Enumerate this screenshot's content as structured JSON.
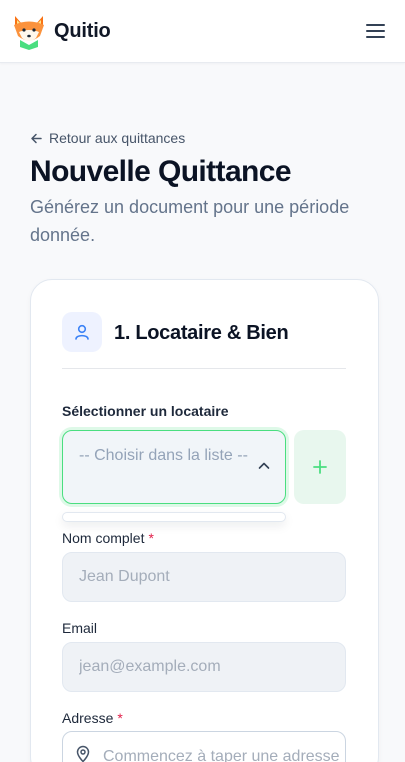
{
  "app": {
    "brand": "Quitio"
  },
  "nav": {
    "back_label": "Retour aux quittances"
  },
  "page": {
    "title": "Nouvelle Quittance",
    "subtitle": "Générez un document pour une période donnée."
  },
  "section": {
    "title": "1. Locataire & Bien"
  },
  "form": {
    "tenant_select": {
      "label": "Sélectionner un locataire",
      "selected": "-- Choisir dans la liste --"
    },
    "full_name": {
      "label": "Nom complet",
      "required_mark": "*",
      "placeholder": "Jean Dupont",
      "value": ""
    },
    "email": {
      "label": "Email",
      "placeholder": "jean@example.com",
      "value": ""
    },
    "address": {
      "label": "Adresse",
      "required_mark": "*",
      "placeholder": "Commencez à taper une adresse",
      "value": ""
    }
  },
  "icons": {
    "logo": "fox-logo-icon",
    "menu": "hamburger-menu-icon",
    "back": "arrow-left-icon",
    "section": "user-icon",
    "chevron": "chevron-up-icon",
    "add": "plus-icon",
    "address": "map-pin-icon"
  },
  "colors": {
    "accent_green": "#4ade80",
    "add_button_bg": "#e8f7ee",
    "section_icon_bg": "#eef2ff",
    "required": "#e11d48"
  }
}
